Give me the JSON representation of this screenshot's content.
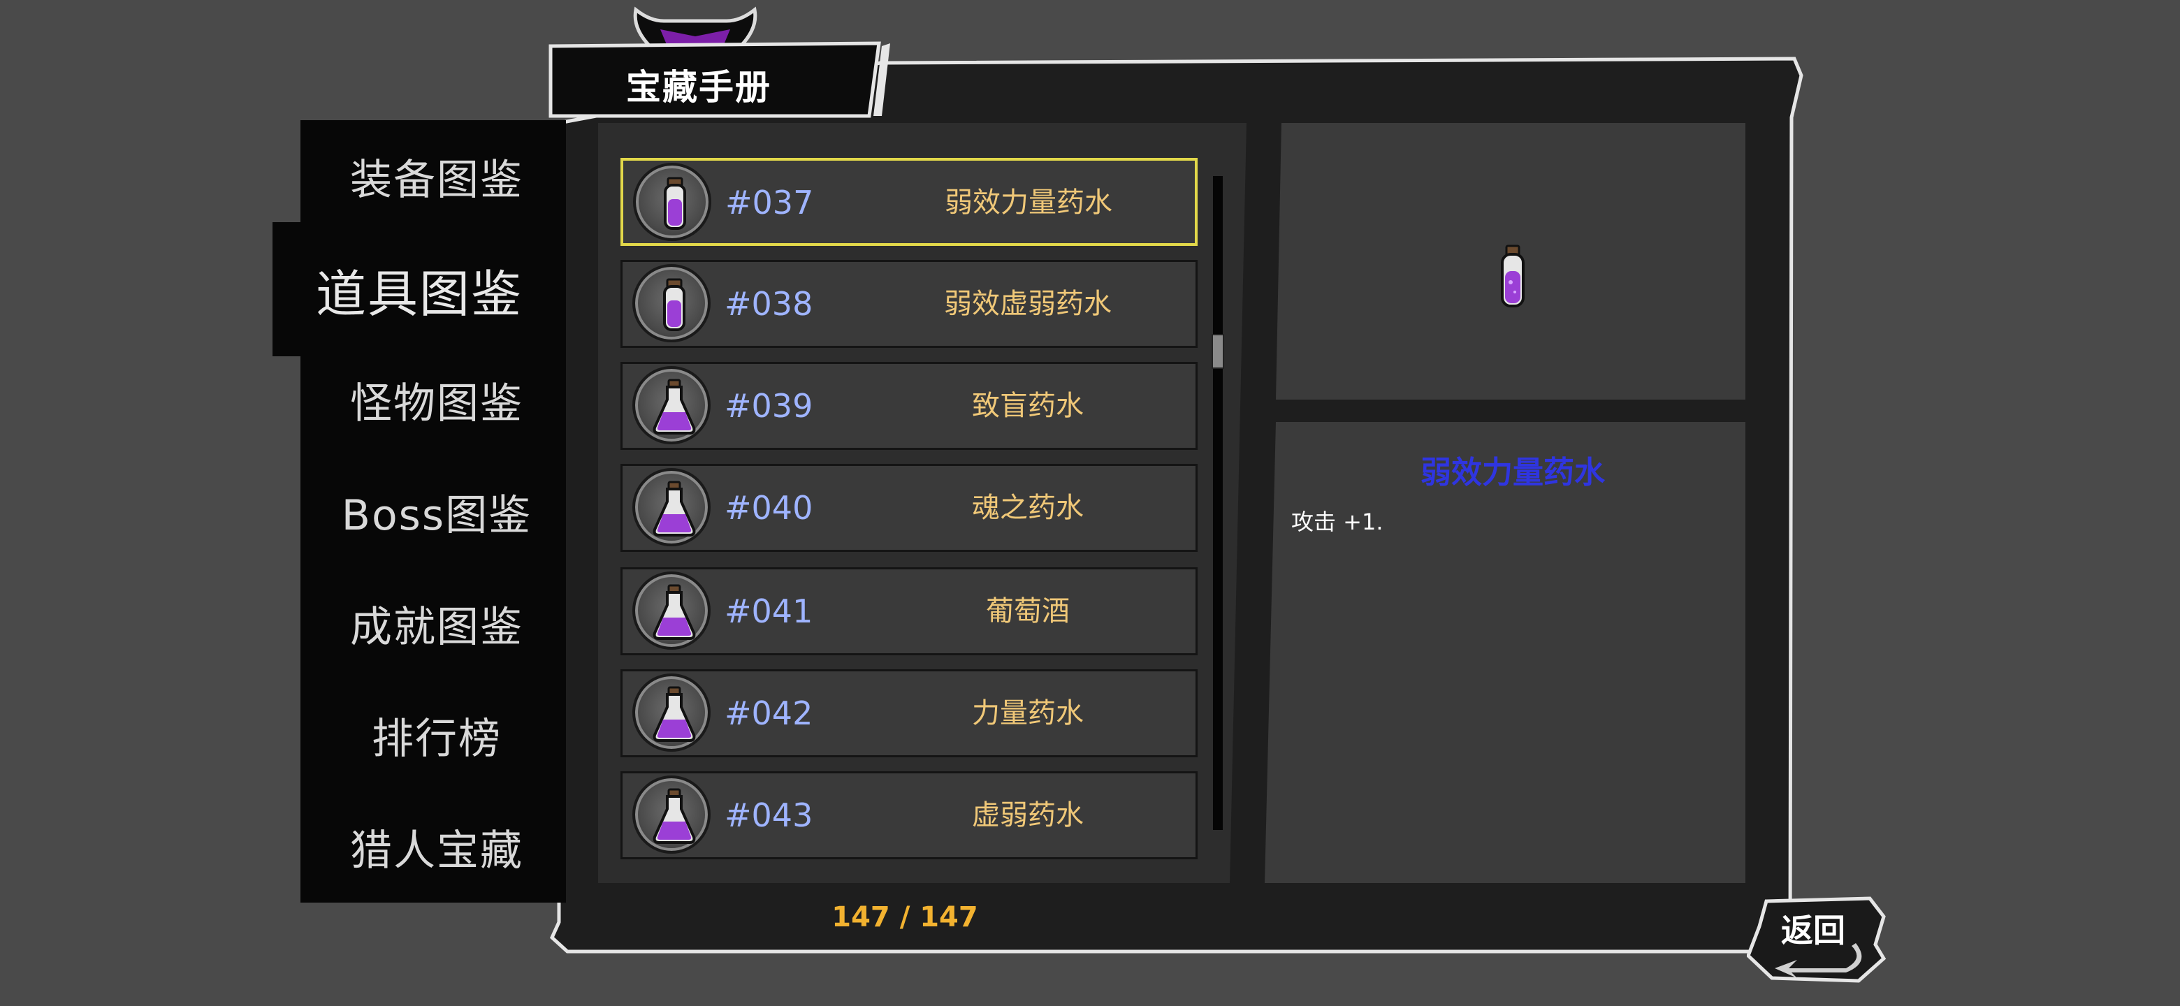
{
  "header": {
    "title": "宝藏手册"
  },
  "tabs": [
    {
      "label": "装备图鉴",
      "active": false
    },
    {
      "label": "道具图鉴",
      "active": true
    },
    {
      "label": "怪物图鉴",
      "active": false
    },
    {
      "label": "Boss图鉴",
      "active": false
    },
    {
      "label": "成就图鉴",
      "active": false
    },
    {
      "label": "排行榜",
      "active": false
    },
    {
      "label": "猎人宝藏",
      "active": false
    }
  ],
  "items": [
    {
      "number": "#037",
      "name": "弱效力量药水",
      "icon": "slim-potion-vial-icon",
      "selected": true
    },
    {
      "number": "#038",
      "name": "弱效虚弱药水",
      "icon": "slim-potion-vial-icon",
      "selected": false
    },
    {
      "number": "#039",
      "name": "致盲药水",
      "icon": "flask-potion-icon",
      "selected": false
    },
    {
      "number": "#040",
      "name": "魂之药水",
      "icon": "flask-potion-icon",
      "selected": false
    },
    {
      "number": "#041",
      "name": "葡萄酒",
      "icon": "flask-potion-icon",
      "selected": false
    },
    {
      "number": "#042",
      "name": "力量药水",
      "icon": "flask-potion-icon",
      "selected": false
    },
    {
      "number": "#043",
      "name": "虚弱药水",
      "icon": "flask-potion-icon",
      "selected": false
    }
  ],
  "counter": "147 / 147",
  "detail": {
    "name": "弱效力量药水",
    "description": "攻击 +1.",
    "icon": "slim-potion-vial-icon"
  },
  "back_button": {
    "label": "返回"
  },
  "colors": {
    "background": "#4a4a4a",
    "panel": "#1e1e1e",
    "item_number": "#9fb4ff",
    "item_name": "#f0c878",
    "selected_border": "#e2d84a",
    "counter": "#f2b230",
    "detail_name": "#2f35e0",
    "potion": "#9b3fd6"
  }
}
